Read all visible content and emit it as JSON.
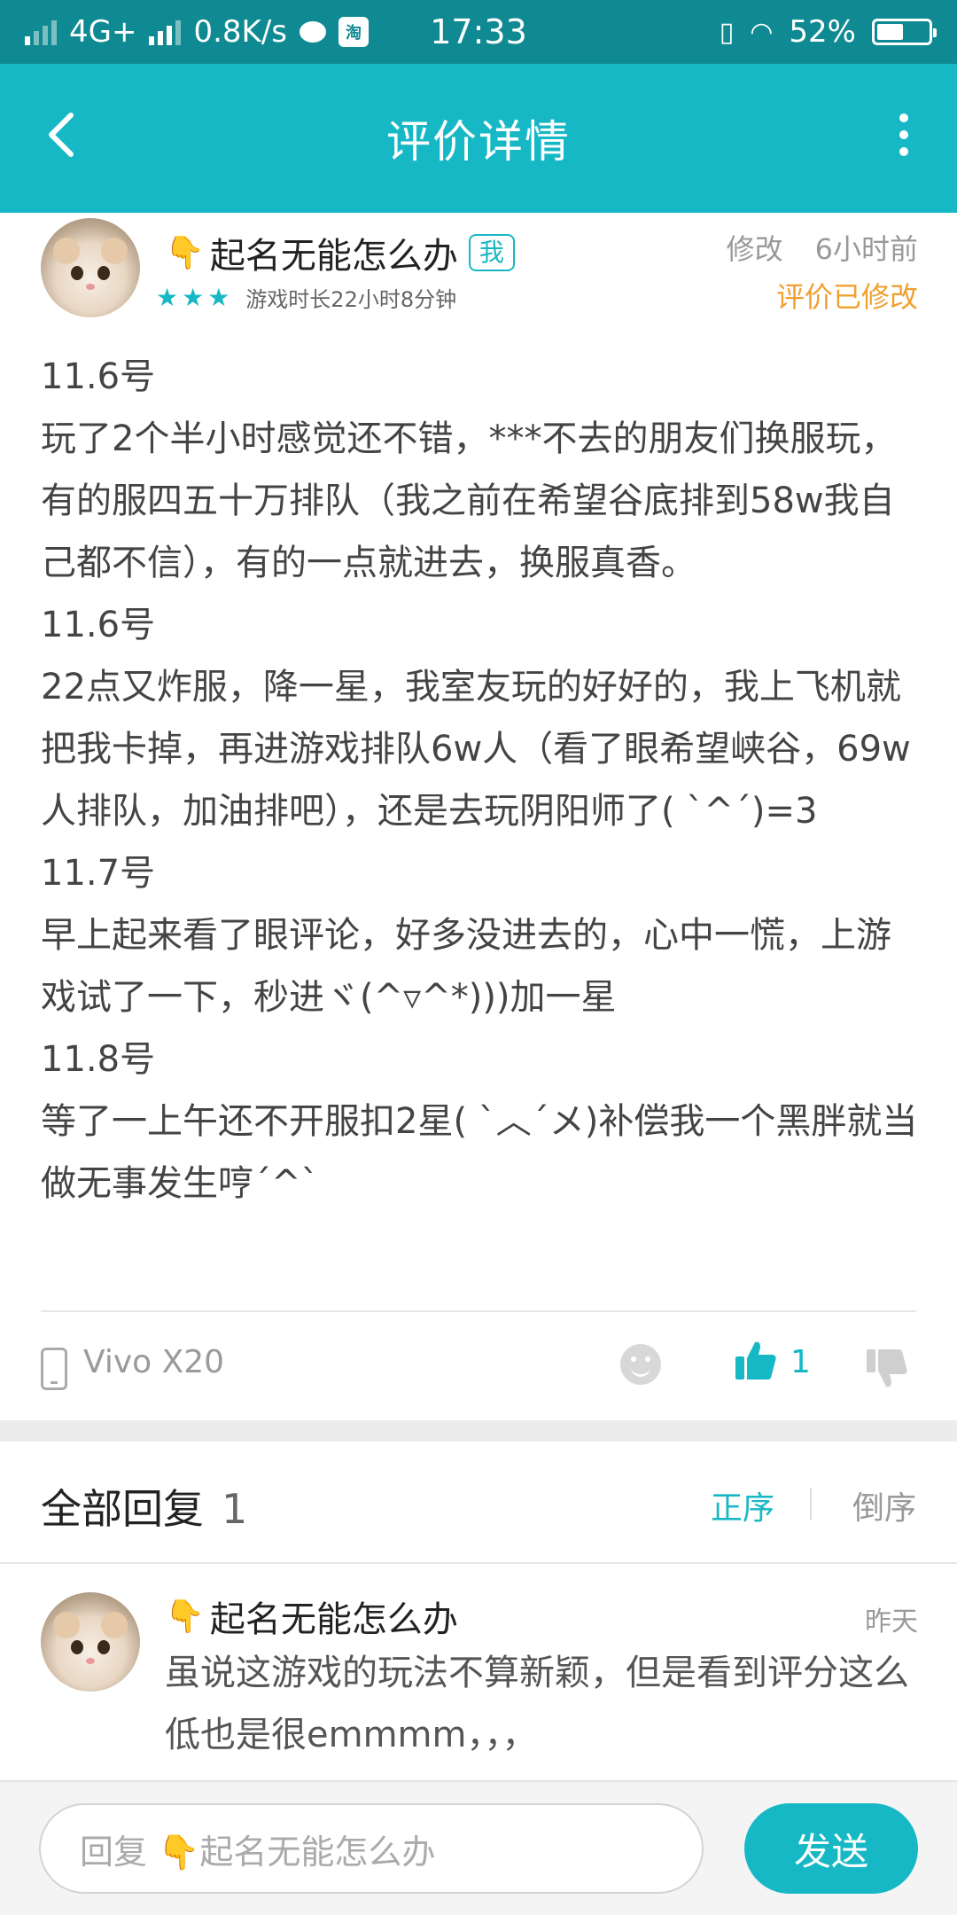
{
  "status_bar": {
    "network": "4G+",
    "speed": "0.8K/s",
    "taobao_glyph": "淘",
    "time": "17:33",
    "battery": "52%",
    "battery_level": 0.52
  },
  "app_bar": {
    "title": "评价详情"
  },
  "review": {
    "user_name": "起名无能怎么办",
    "me_badge": "我",
    "stars": "★★★",
    "rating": 3,
    "play_time": "游戏时长22小时8分钟",
    "edit_label": "修改",
    "time_ago": "6小时前",
    "modified_label": "评价已修改",
    "body": "11.6号\n玩了2个半小时感觉还不错，***不去的朋友们换服玩，有的服四五十万排队（我之前在希望谷底排到58w我自己都不信），有的一点就进去，换服真香。\n11.6号\n22点又炸服，降一星，我室友玩的好好的，我上飞机就把我卡掉，再进游戏排队6w人（看了眼希望峡谷，69w人排队，加油排吧），还是去玩阴阳师了( ˋ^ˊ)=3\n11.7号\n早上起来看了眼评论，好多没进去的，心中一慌，上游戏试了一下，秒进ヾ(^▿^*)))加一星\n11.8号\n等了一上午还不开服扣2星( ˋ︿ˊメ)补偿我一个黑胖就当做无事发生哼ˊ^ˋ",
    "device": "Vivo X20",
    "like_count": "1"
  },
  "replies": {
    "title": "全部回复",
    "count": "1",
    "sort_asc": "正序",
    "sort_desc": "倒序",
    "items": [
      {
        "user_name": "起名无能怎么办",
        "time": "昨天",
        "body": "虽说这游戏的玩法不算新颖，但是看到评分这么低也是很emmmm，，，"
      }
    ]
  },
  "bottom_bar": {
    "placeholder": "回复 👇起名无能怎么办",
    "send_label": "发送"
  },
  "colors": {
    "accent": "#17b8c5",
    "status_bar": "#0f8a93",
    "modified": "#f0a030"
  }
}
